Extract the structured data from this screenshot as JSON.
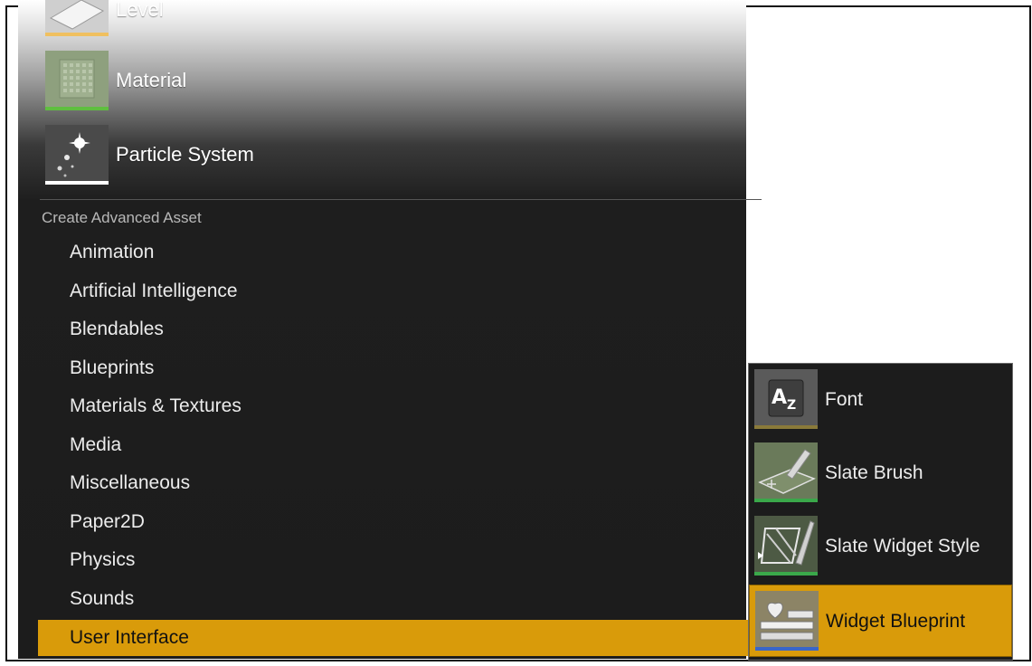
{
  "menu": {
    "assets": [
      {
        "label": "Level",
        "icon": "level-icon",
        "accent": "#f0c060"
      },
      {
        "label": "Material",
        "icon": "material-icon",
        "accent": "#5fbf3f"
      },
      {
        "label": "Particle System",
        "icon": "particle-system-icon",
        "accent": "#ffffff"
      }
    ],
    "section_header": "Create Advanced Asset",
    "items": [
      {
        "label": "Animation"
      },
      {
        "label": "Artificial Intelligence"
      },
      {
        "label": "Blendables"
      },
      {
        "label": "Blueprints"
      },
      {
        "label": "Materials & Textures"
      },
      {
        "label": "Media"
      },
      {
        "label": "Miscellaneous"
      },
      {
        "label": "Paper2D"
      },
      {
        "label": "Physics"
      },
      {
        "label": "Sounds"
      },
      {
        "label": "User Interface",
        "selected": true
      }
    ]
  },
  "submenu": {
    "items": [
      {
        "label": "Font",
        "icon": "font-icon",
        "accent": "#8a7a3a"
      },
      {
        "label": "Slate Brush",
        "icon": "slate-brush-icon",
        "accent": "#3aa84a"
      },
      {
        "label": "Slate Widget Style",
        "icon": "slate-widget-style-icon",
        "accent": "#3aa84a"
      },
      {
        "label": "Widget Blueprint",
        "icon": "widget-blueprint-icon",
        "accent": "#3a66c8",
        "selected": true
      }
    ]
  },
  "colors": {
    "selection": "#d99b0a",
    "menu_background": "#1c1c1c"
  }
}
